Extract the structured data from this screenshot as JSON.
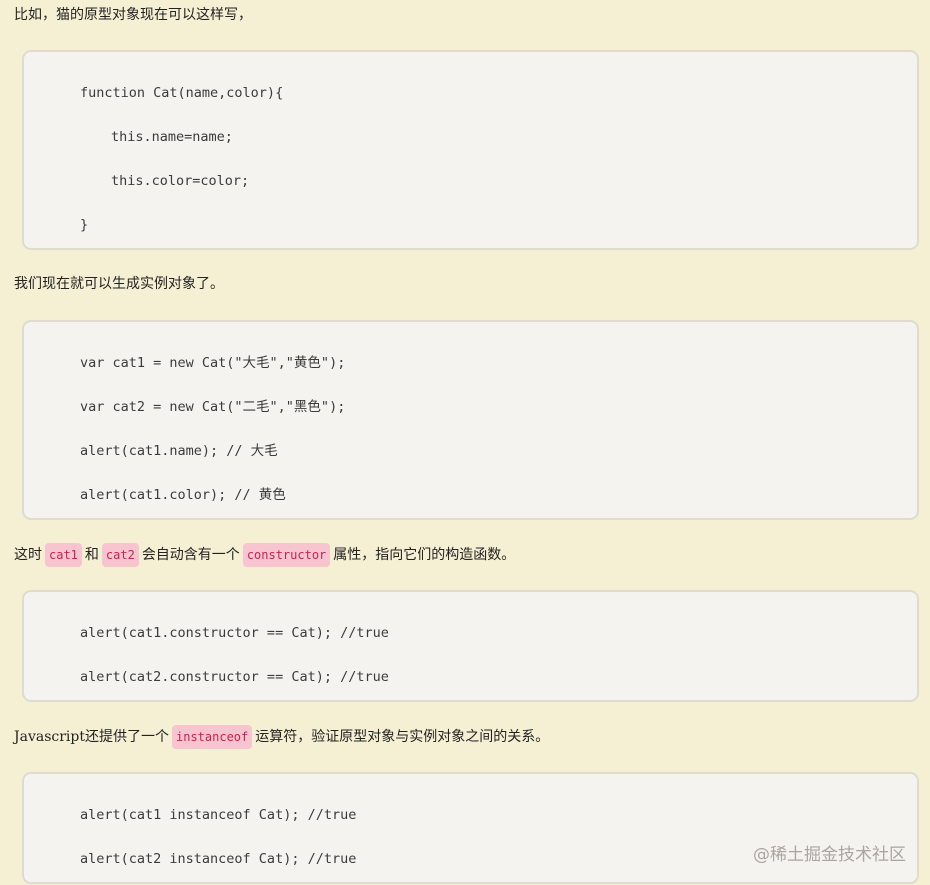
{
  "paragraphs": {
    "p1": "比如，猫的原型对象现在可以这样写，",
    "p2": "我们现在就可以生成实例对象了。",
    "p3": {
      "before": "这时",
      "code1": "cat1",
      "mid1": "和",
      "code2": "cat2",
      "mid2": "会自动含有一个",
      "code3": "constructor",
      "after": "属性，指向它们的构造函数。"
    },
    "p4": {
      "before": "Javascript还提供了一个",
      "code1": "instanceof",
      "after": "运算符，验证原型对象与实例对象之间的关系。"
    }
  },
  "code_blocks": {
    "block1": [
      "function Cat(name,color){",
      "this.name=name;",
      "this.color=color;",
      "}"
    ],
    "block2": [
      "var cat1 = new Cat(\"大毛\",\"黄色\");",
      "var cat2 = new Cat(\"二毛\",\"黑色\");",
      "alert(cat1.name); // 大毛",
      "alert(cat1.color); // 黄色"
    ],
    "block3": [
      "alert(cat1.constructor == Cat); //true",
      "alert(cat2.constructor == Cat); //true"
    ],
    "block4": [
      "alert(cat1 instanceof Cat); //true",
      "alert(cat2 instanceof Cat); //true"
    ]
  },
  "watermark": "@稀土掘金技术社区",
  "colors": {
    "page_background": "#f5f0d3",
    "code_background": "#f5f3f0",
    "code_border": "#dedbcf",
    "inline_code_background": "#f7c4cf",
    "inline_code_text": "#c7254e"
  }
}
